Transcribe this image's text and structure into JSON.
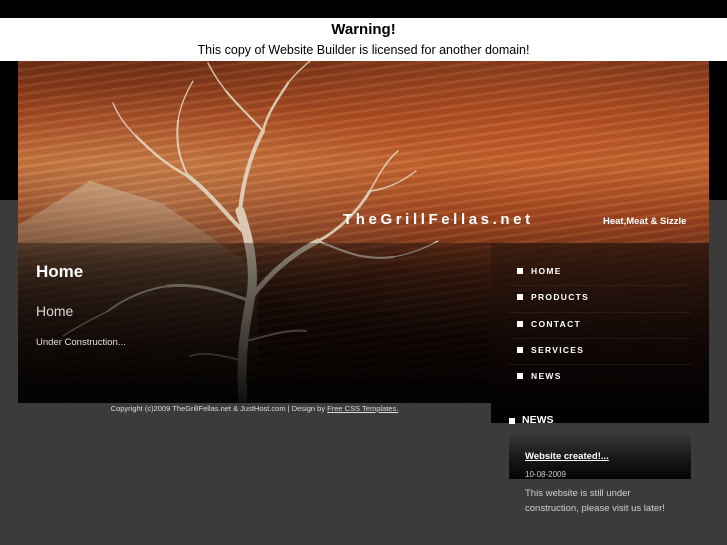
{
  "warning": {
    "title": "Warning!",
    "message": "This copy of Website Builder is licensed for another domain!"
  },
  "site": {
    "brand": "TheGrillFellas.net",
    "tagline": "Heat,Meat & Sizzle"
  },
  "content": {
    "title": "Home",
    "subtitle": "Home",
    "body": "Under Construction..."
  },
  "nav": {
    "items": [
      {
        "label": "HOME"
      },
      {
        "label": "PRODUCTS"
      },
      {
        "label": "CONTACT"
      },
      {
        "label": "SERVICES"
      },
      {
        "label": "NEWS"
      }
    ]
  },
  "news": {
    "heading": "NEWS",
    "item": {
      "title": "Website created!...",
      "date": "10-08-2009",
      "body": "This website is still under construction, please visit us later!"
    }
  },
  "footer": {
    "copyright": "Copyright (c)2009 TheGrillFellas.net & JustHost.com | Design by",
    "link_text": "Free CSS Templates."
  },
  "colors": {
    "background": "#3b3b3b",
    "header_black": "#000000",
    "warning_bg": "#ffffff",
    "canyon_accent": "#c46b34"
  }
}
